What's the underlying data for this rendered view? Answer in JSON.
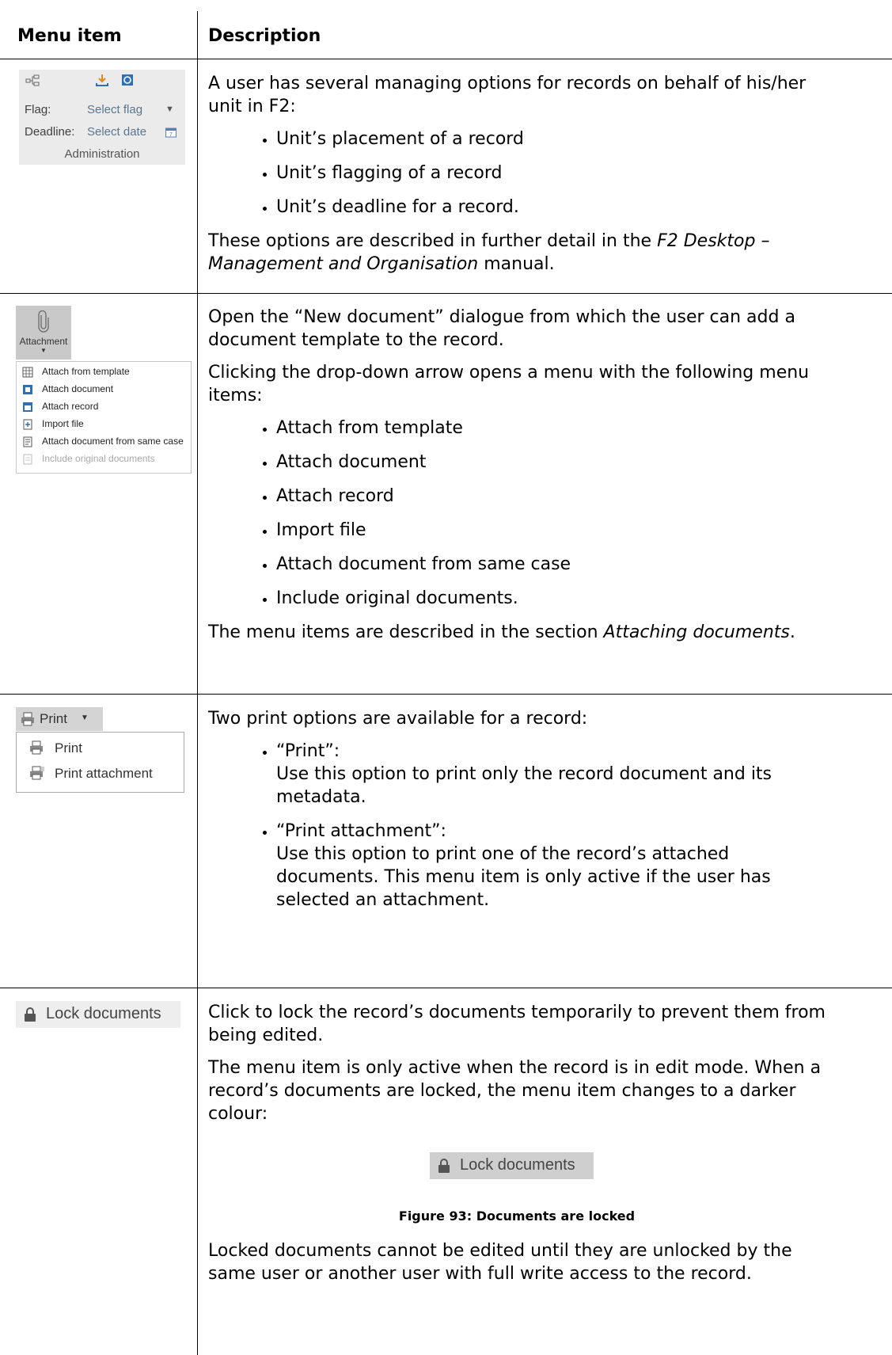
{
  "header": {
    "col1": "Menu item",
    "col2": "Description"
  },
  "administration": {
    "flag_label": "Flag:",
    "flag_value": "Select flag",
    "deadline_label": "Deadline:",
    "deadline_value": "Select date",
    "group_label": "Administration"
  },
  "row1": {
    "intro": "A user has several managing options for records on behalf of his/her unit in F2:",
    "bullets": [
      "Unit’s placement of a record",
      "Unit’s flagging of a record",
      "Unit’s deadline for a record."
    ],
    "outro_pre": "These options are described in further detail in the ",
    "outro_em": "F2 Desktop – Management and Organisation",
    "outro_post": " manual."
  },
  "attachment": {
    "button_label": "Attachment",
    "menu": [
      "Attach from template",
      "Attach  document",
      "Attach record",
      "Import file",
      "Attach document from same case",
      "Include original documents"
    ]
  },
  "row2": {
    "p1": "Open the “New document” dialogue from which the user can add a document template to the record.",
    "p2": "Clicking the drop-down arrow opens a menu with the following menu items:",
    "bullets": [
      "Attach from template",
      "Attach document",
      "Attach record",
      "Import file",
      "Attach document from same case",
      "Include original documents."
    ],
    "outro_pre": "The menu items are described in the section ",
    "outro_em": "Attaching documents",
    "outro_post": "."
  },
  "print": {
    "button_label": "Print",
    "menu": [
      "Print",
      "Print attachment"
    ]
  },
  "row3": {
    "intro": "Two print options are available for a record:",
    "b1_title": "“Print”:",
    "b1_text": "Use this option to print only the record document and its metadata.",
    "b2_title": "“Print attachment”:",
    "b2_text": "Use this option to print one of the record’s attached documents. This menu item is only active if the user has selected an attachment."
  },
  "lock": {
    "button_label": "Lock documents"
  },
  "row4": {
    "p1": "Click to lock the record’s documents temporarily to prevent them from being edited.",
    "p2": "The menu item is only active when the record is in edit mode. When a record’s documents are locked, the menu item changes to a darker colour:",
    "figure_caption": "Figure 93: Documents are locked",
    "p3": "Locked documents cannot be edited until they are unlocked by the same user or another user with full write access to the record."
  },
  "colors": {
    "panel_bg": "#ebebeb",
    "button_active": "#c9c9c9",
    "lock_light": "#eeeeee",
    "lock_dark": "#cfcfcf"
  }
}
